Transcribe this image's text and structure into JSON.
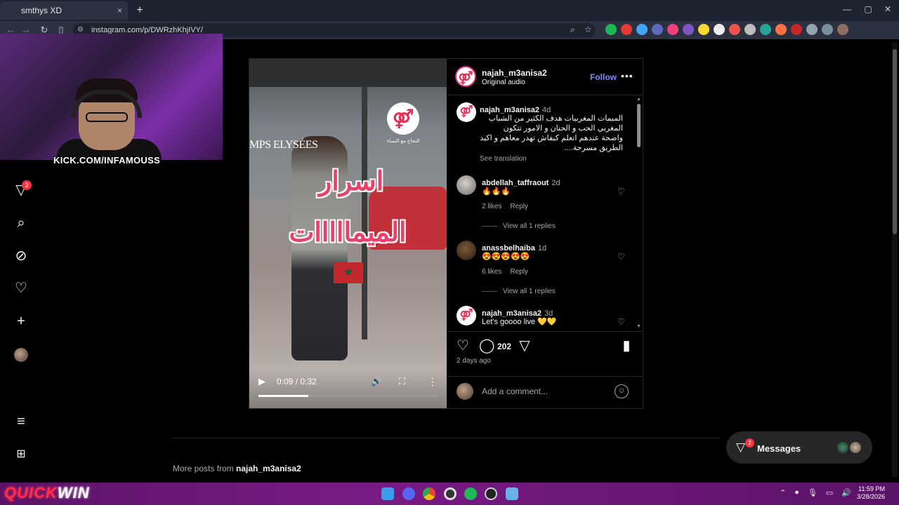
{
  "browser": {
    "tab_title": "smthys XD",
    "new_tab": "+",
    "tab_close": "×",
    "url": "instagram.com/p/DWRzhKhjIVY/",
    "window_controls": [
      "—",
      "▢",
      "✕"
    ]
  },
  "webcam": {
    "overlay_text": "KICK.COM/INFAMOUSS"
  },
  "sidebar": {
    "notifications_badge": "3"
  },
  "post": {
    "username": "najah_m3anisa2",
    "audio": "Original audio",
    "follow_label": "Follow",
    "more_label": "•••",
    "video": {
      "logo_glyph": "⚤",
      "logo_caption": "النجاح مع النساء",
      "sign_text": "MPS ELYSÉES",
      "title_line1": "اسرار",
      "title_line2": "الميمااااات",
      "time": "0:09 / 0:32",
      "progress": 0.28
    },
    "caption": {
      "username": "najah_m3anisa2",
      "time": "4d",
      "text": "الميمات المغربيات هدف الكثير من الشباب المغربي الحب و الحنان و الامور تتكون واضحة عندهم اتعلم كيفاش تهدر معاهم و اكيد الطريق مسرحة....",
      "see_translation": "See translation"
    },
    "comments": [
      {
        "username": "abdellah_taffraout",
        "time": "2d",
        "text": "🔥🔥🔥",
        "likes": "2 likes",
        "reply": "Reply",
        "view_replies": "View all 1 replies"
      },
      {
        "username": "anassbelhaiba",
        "time": "1d",
        "text": "😍😍😍😍😍",
        "likes": "6 likes",
        "reply": "Reply",
        "view_replies": "View all 1 replies"
      },
      {
        "username": "najah_m3anisa2",
        "time": "3d",
        "text": "Let's goooo live 💛💛"
      }
    ],
    "comment_count": "202",
    "age": "2 days ago",
    "add_comment_placeholder": "Add a comment...",
    "emoji_label": "☺"
  },
  "footer": {
    "more_posts_prefix": "More posts from",
    "more_posts_user": "najah_m3anisa2"
  },
  "messages": {
    "label": "Messages",
    "badge": "2"
  },
  "taskbar": {
    "brand_red": "QUICK",
    "brand_white": "WIN",
    "clock_time": "11:59 PM",
    "clock_date": "3/28/2026"
  }
}
